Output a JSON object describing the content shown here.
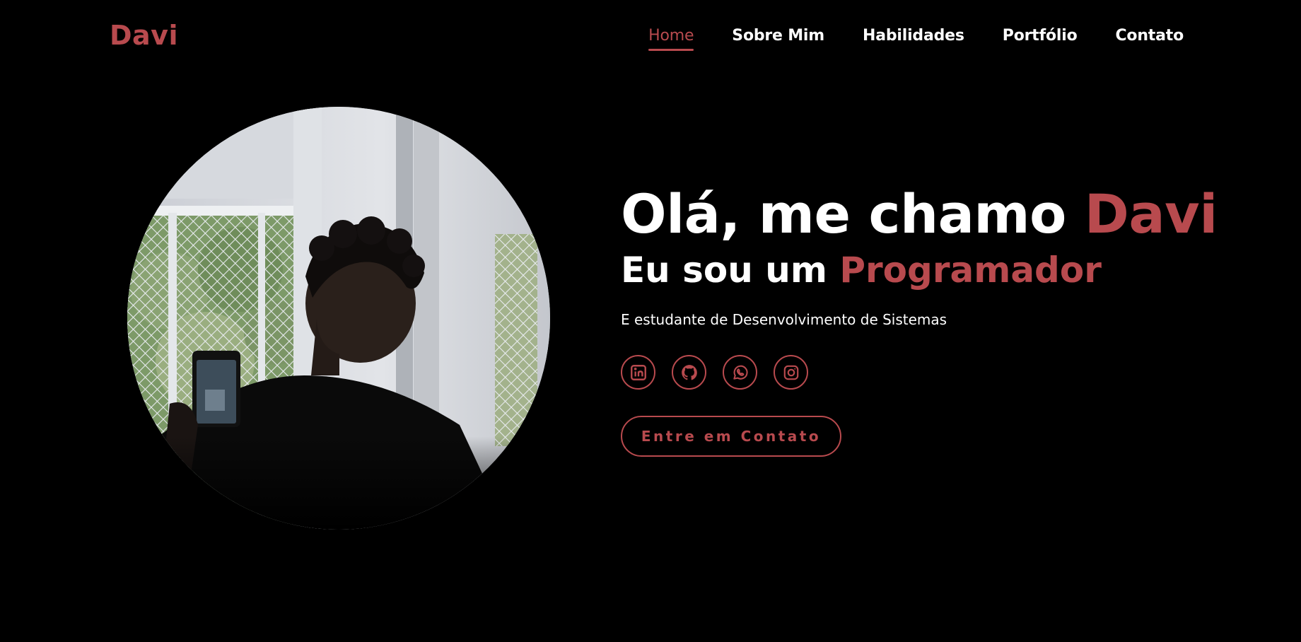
{
  "header": {
    "logo": "Davi",
    "nav": [
      {
        "label": "Home",
        "active": true
      },
      {
        "label": "Sobre Mim",
        "active": false
      },
      {
        "label": "Habilidades",
        "active": false
      },
      {
        "label": "Portfólio",
        "active": false
      },
      {
        "label": "Contato",
        "active": false
      }
    ]
  },
  "hero": {
    "greeting_prefix": "Olá, me chamo ",
    "greeting_name": "Davi",
    "role_prefix": "Eu sou um ",
    "role_highlight": "Programador",
    "subtitle": "E estudante de Desenvolvimento de Sistemas",
    "socials": [
      {
        "icon": "linkedin-icon"
      },
      {
        "icon": "github-icon"
      },
      {
        "icon": "whatsapp-icon"
      },
      {
        "icon": "instagram-icon"
      }
    ],
    "cta_label": "Entre em Contato"
  },
  "colors": {
    "background": "#000000",
    "accent": "#b84a4e",
    "text": "#ffffff"
  }
}
